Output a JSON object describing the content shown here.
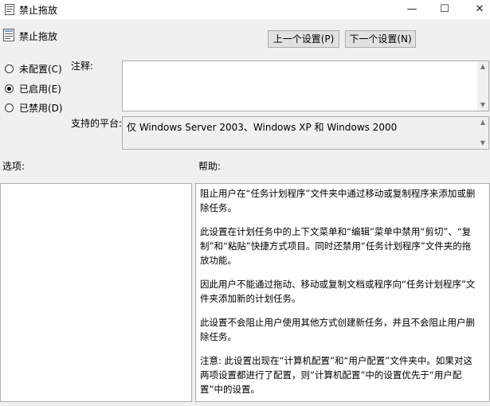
{
  "window": {
    "title": "禁止拖放",
    "min_glyph": "—",
    "max_glyph": "☐",
    "close_glyph": "✕"
  },
  "header": {
    "policy_name": "禁止拖放",
    "prev_button": "上一个设置(P)",
    "next_button": "下一个设置(N)"
  },
  "state": {
    "options": [
      {
        "label": "未配置(C)",
        "selected": false
      },
      {
        "label": "已启用(E)",
        "selected": true
      },
      {
        "label": "已禁用(D)",
        "selected": false
      }
    ]
  },
  "comment": {
    "label": "注释:",
    "value": ""
  },
  "platform": {
    "label": "支持的平台:",
    "value": "仅 Windows Server 2003、Windows XP 和 Windows 2000"
  },
  "options_label": "选项:",
  "help": {
    "label": "帮助:",
    "paragraphs": [
      "阻止用户在“任务计划程序”文件夹中通过移动或复制程序来添加或删除任务。",
      "此设置在计划任务中的上下文菜单和“编辑”菜单中禁用“剪切”、“复制”和“粘贴”快捷方式项目。同时还禁用“任务计划程序”文件夹的拖放功能。",
      "因此用户不能通过拖动、移动或复制文档或程序向“任务计划程序”文件夹添加新的计划任务。",
      "此设置不会阻止用户使用其他方式创建新任务，并且不会阻止用户删除任务。",
      "注意: 此设置出现在“计算机配置”和“用户配置”文件夹中。如果对这两项设置都进行了配置，则“计算机配置”中的设置优先于“用户配置”中的设置。"
    ]
  }
}
